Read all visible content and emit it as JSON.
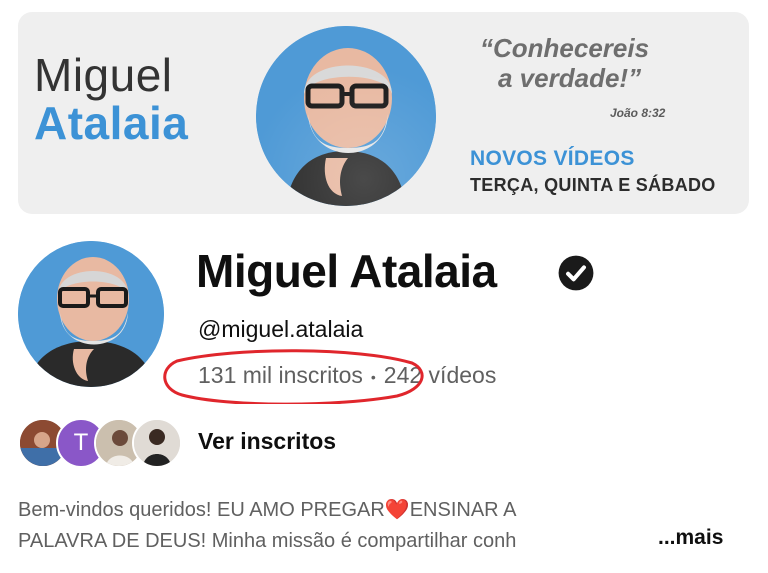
{
  "banner": {
    "first_name": "Miguel",
    "last_name": "Atalaia",
    "quote_line1": "“Conhecereis",
    "quote_line2": "a verdade!”",
    "quote_ref": "João 8:32",
    "new_videos": "NOVOS VÍDEOS",
    "schedule": "TERÇA, QUINTA E SÁBADO",
    "accent_color": "#3c92d6"
  },
  "profile": {
    "name": "Miguel Atalaia",
    "verified_icon": "verified-check-icon",
    "handle": "@miguel.atalaia",
    "subscribers": "131 mil inscritos",
    "separator": "•",
    "videos": "242 vídeos",
    "highlight_color": "#e0262c"
  },
  "subscribers_row": {
    "letter_avatar": "T",
    "link_label": "Ver inscritos"
  },
  "description": {
    "line1_a": "Bem-vindos queridos!  EU AMO PREGAR",
    "heart": "❤️",
    "line1_b": "ENSINAR A",
    "line2": "PALAVRA DE DEUS! Minha missão é compartilhar conh",
    "more_label": "...mais"
  }
}
